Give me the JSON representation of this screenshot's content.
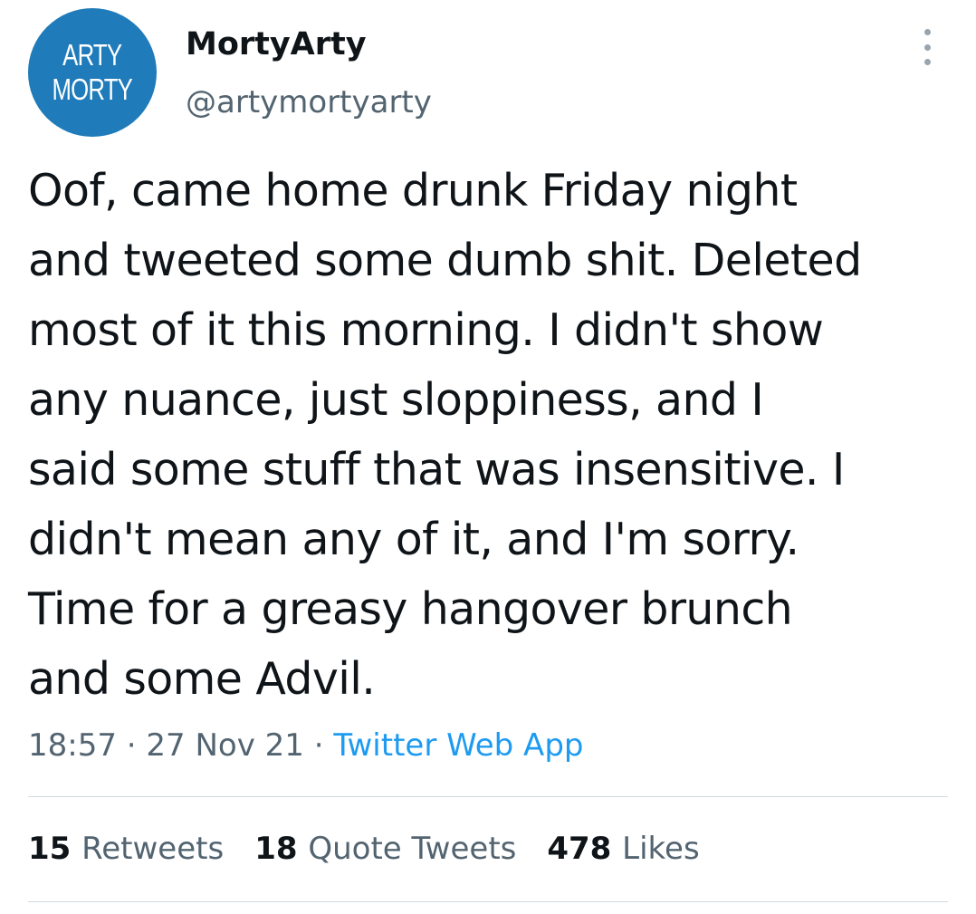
{
  "tweet": {
    "avatar": {
      "line1": "ARTY",
      "line2": "MORTY",
      "color": "#1f7bb9"
    },
    "display_name": "MortyArty",
    "handle": "@artymortyarty",
    "more_icon": "more-options-icon",
    "text_lines": [
      "Oof, came home drunk Friday night",
      "and tweeted some dumb shit. Deleted",
      "most of it this morning. I didn't show",
      "any nuance, just sloppiness, and I",
      "said some stuff that was insensitive. I",
      "didn't mean any of it, and I'm sorry.",
      "Time for a greasy hangover brunch",
      "and some Advil."
    ],
    "time": "18:57",
    "separator": "·",
    "date": "27 Nov 21",
    "source": "Twitter Web App",
    "stats": {
      "retweets_count": "15",
      "retweets_label": "Retweets",
      "quotes_count": "18",
      "quotes_label": "Quote Tweets",
      "likes_count": "478",
      "likes_label": "Likes"
    }
  }
}
